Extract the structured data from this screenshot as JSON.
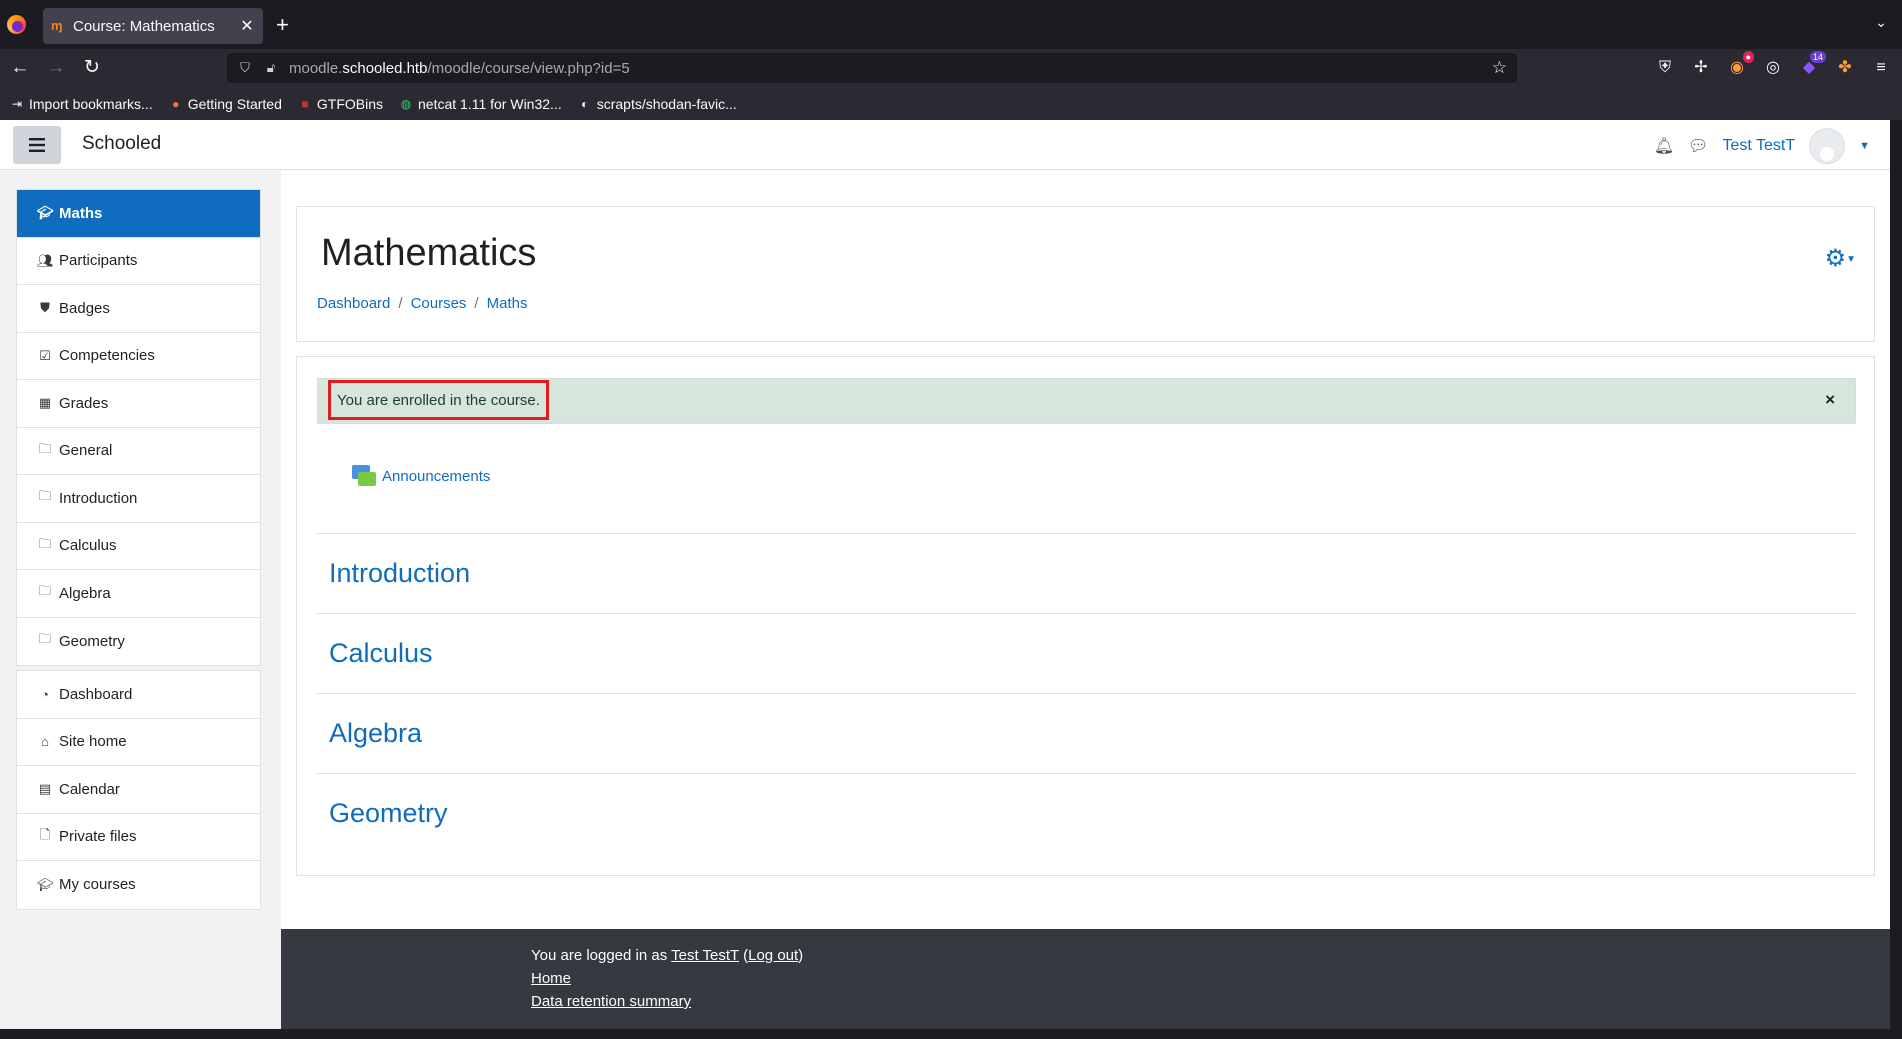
{
  "browser": {
    "tab_title": "Course: Mathematics",
    "tab_favicon": "moodle-icon",
    "url_host_prefix": "moodle.",
    "url_host": "schooled.htb",
    "url_path": "/moodle/course/view.php?id=5",
    "bookmarks": [
      {
        "label": "Import bookmarks...",
        "icon": "import-icon"
      },
      {
        "label": "Getting Started",
        "icon": "firefox-icon"
      },
      {
        "label": "GTFOBins",
        "icon": "gtfobins-icon"
      },
      {
        "label": "netcat 1.11 for Win32...",
        "icon": "netcat-icon"
      },
      {
        "label": "scrapts/shodan-favic...",
        "icon": "github-icon"
      }
    ],
    "extension_badge_count": "14"
  },
  "header": {
    "site_name": "Schooled",
    "user_name": "Test TestT"
  },
  "sidebar": {
    "course_items": [
      {
        "label": "Maths",
        "icon": "graduation-cap-icon",
        "active": true
      },
      {
        "label": "Participants",
        "icon": "users-icon"
      },
      {
        "label": "Badges",
        "icon": "shield-icon"
      },
      {
        "label": "Competencies",
        "icon": "checkbox-icon"
      },
      {
        "label": "Grades",
        "icon": "table-icon"
      },
      {
        "label": "General",
        "icon": "folder-icon"
      },
      {
        "label": "Introduction",
        "icon": "folder-icon"
      },
      {
        "label": "Calculus",
        "icon": "folder-icon"
      },
      {
        "label": "Algebra",
        "icon": "folder-icon"
      },
      {
        "label": "Geometry",
        "icon": "folder-icon"
      }
    ],
    "site_items": [
      {
        "label": "Dashboard",
        "icon": "dashboard-icon"
      },
      {
        "label": "Site home",
        "icon": "home-icon"
      },
      {
        "label": "Calendar",
        "icon": "calendar-icon"
      },
      {
        "label": "Private files",
        "icon": "file-icon"
      },
      {
        "label": "My courses",
        "icon": "graduation-cap-icon"
      }
    ]
  },
  "page": {
    "title": "Mathematics",
    "breadcrumbs": [
      "Dashboard",
      "Courses",
      "Maths"
    ],
    "breadcrumb_separator": "/"
  },
  "course": {
    "alert_message": "You are enrolled in the course.",
    "alert_close": "×",
    "announcements_label": "Announcements",
    "sections": [
      "Introduction",
      "Calculus",
      "Algebra",
      "Geometry"
    ]
  },
  "footer": {
    "logged_in_prefix": "You are logged in as",
    "user_link": "Test TestT",
    "logout_label": "Log out",
    "home_label": "Home",
    "data_retention_label": "Data retention summary"
  },
  "colors": {
    "accent": "#0f6cbf",
    "alert_bg": "#d7e6dd",
    "highlight_border": "#e01b24",
    "footer_bg": "#343a40"
  }
}
